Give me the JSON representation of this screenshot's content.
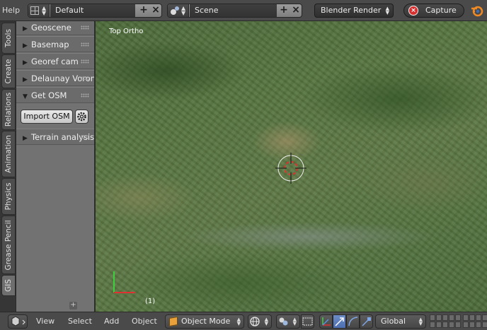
{
  "topbar": {
    "help_menu": "Help",
    "screen_layout": "Default",
    "scene": "Scene",
    "render_engine": "Blender Render",
    "capture_label": "Capture"
  },
  "tabs": [
    "Tools",
    "Create",
    "Relations",
    "Animation",
    "Physics",
    "Grease Pencil",
    "GIS"
  ],
  "active_tab": "GIS",
  "shelf": {
    "panels": [
      {
        "label": "Geoscene",
        "expanded": false
      },
      {
        "label": "Basemap",
        "expanded": false
      },
      {
        "label": "Georef cam",
        "expanded": false
      },
      {
        "label": "Delaunay Voronoi",
        "expanded": false
      },
      {
        "label": "Get OSM",
        "expanded": true
      },
      {
        "label": "Terrain analysis",
        "expanded": false
      }
    ],
    "import_osm_label": "Import OSM"
  },
  "viewport": {
    "view_label": "Top Ortho",
    "frame_label": "(1)"
  },
  "bottombar": {
    "menus": [
      "View",
      "Select",
      "Add",
      "Object"
    ],
    "mode": "Object Mode",
    "orientation": "Global"
  },
  "colors": {
    "header_bg": "#4a4a4a",
    "shelf_bg": "#727272",
    "capture_red": "#d62f2f",
    "object_orange": "#e9a23b",
    "active_blue": "#5d7fc0"
  }
}
